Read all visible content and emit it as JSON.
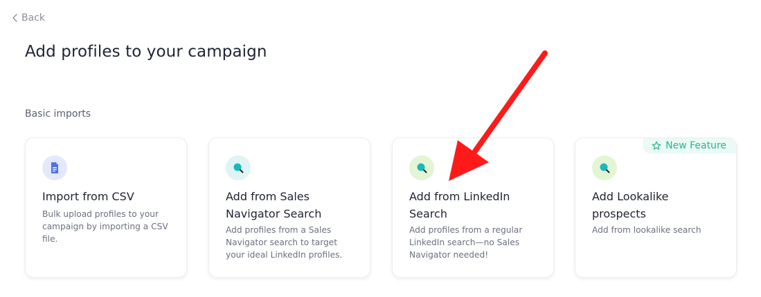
{
  "back": {
    "label": "Back"
  },
  "page": {
    "title": "Add profiles to your campaign"
  },
  "section": {
    "label": "Basic imports"
  },
  "cards": [
    {
      "title": "Import from CSV",
      "description": "Bulk upload profiles to your campaign by importing a CSV file.",
      "icon": "document-icon",
      "icon_bg": "#e3e9fb",
      "icon_color": "#4e72e8"
    },
    {
      "title": "Add from Sales Navigator Search",
      "description": "Add profiles from a Sales Navigator search to target your ideal LinkedIn profiles.",
      "icon": "search-icon",
      "icon_bg": "#dff4f4",
      "icon_color": "#1bb7bd"
    },
    {
      "title": "Add from LinkedIn Search",
      "description": "Add profiles from a regular LinkedIn search—no Sales Navigator needed!",
      "icon": "search-icon",
      "icon_bg": "#e3f5d4",
      "icon_color": "#1bb7bd"
    },
    {
      "title": "Add Lookalike prospects",
      "description": "Add from lookalike search",
      "icon": "search-icon",
      "icon_bg": "#e3f5d4",
      "icon_color": "#1bb7bd",
      "badge": "New Feature"
    }
  ],
  "colors": {
    "annotation_arrow": "#ff1a1a",
    "badge_text": "#2bb58a"
  }
}
